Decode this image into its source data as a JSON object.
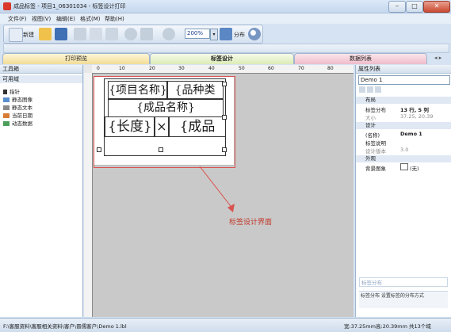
{
  "window": {
    "title": "成品标签 - 项目1_06301034 - 标签设计打印"
  },
  "menu": [
    "文件(F)",
    "视图(V)",
    "编辑(E)",
    "格式(M)",
    "帮助(H)"
  ],
  "toolbar": {
    "new_label": "新建",
    "zoom_value": "200%",
    "distribute_label": "分布"
  },
  "tabs": {
    "print_preview": "打印预览",
    "label_design": "标签设计",
    "data_list": "数据列表"
  },
  "toolbox": {
    "title": "工具箱",
    "section": "可用域",
    "items": [
      "指针",
      "静态图像",
      "静态文本",
      "当前日期",
      "动态数据"
    ]
  },
  "ruler": {
    "marks": [
      "0",
      "10",
      "20",
      "30",
      "40",
      "50",
      "60",
      "70",
      "80"
    ]
  },
  "label": {
    "cell_project": "{项目名称}",
    "cell_variety": "{品种类",
    "cell_product": "{成品名称}",
    "cell_length": "{长度}",
    "cell_times": "×",
    "cell_product2": "{成品"
  },
  "annotation": "标签设计界面",
  "properties": {
    "title": "属性列表",
    "selected": "Demo 1",
    "categories": {
      "layout": "布局",
      "design": "设计",
      "appearance": "外观"
    },
    "rows": {
      "distribution_key": "标签分布",
      "distribution_val": "13 行, 5 列",
      "size_key": "大小",
      "size_val": "37.25, 20.39",
      "name_key": "(名称)",
      "name_val": "Demo 1",
      "desc_key": "标签说明",
      "desc_val": "",
      "version_key": "设计版本",
      "version_val": "3.0",
      "bg_key": "背景图象",
      "bg_val": "(无)"
    },
    "footer_title": "标签分布",
    "footer_desc": "标签分布 设置标签的分布方式"
  },
  "status": {
    "path": "F:\\客服资料\\客服相关资料\\客户\\晋儒客户\\Demo 1.lbl",
    "width": "宽:37.25mm",
    "height": "高:20.39mm",
    "total": "共13个域"
  },
  "colors": {
    "accent": "#d9534f",
    "titlebar": "#dce9f7",
    "active_tab": "#eef6d8"
  }
}
